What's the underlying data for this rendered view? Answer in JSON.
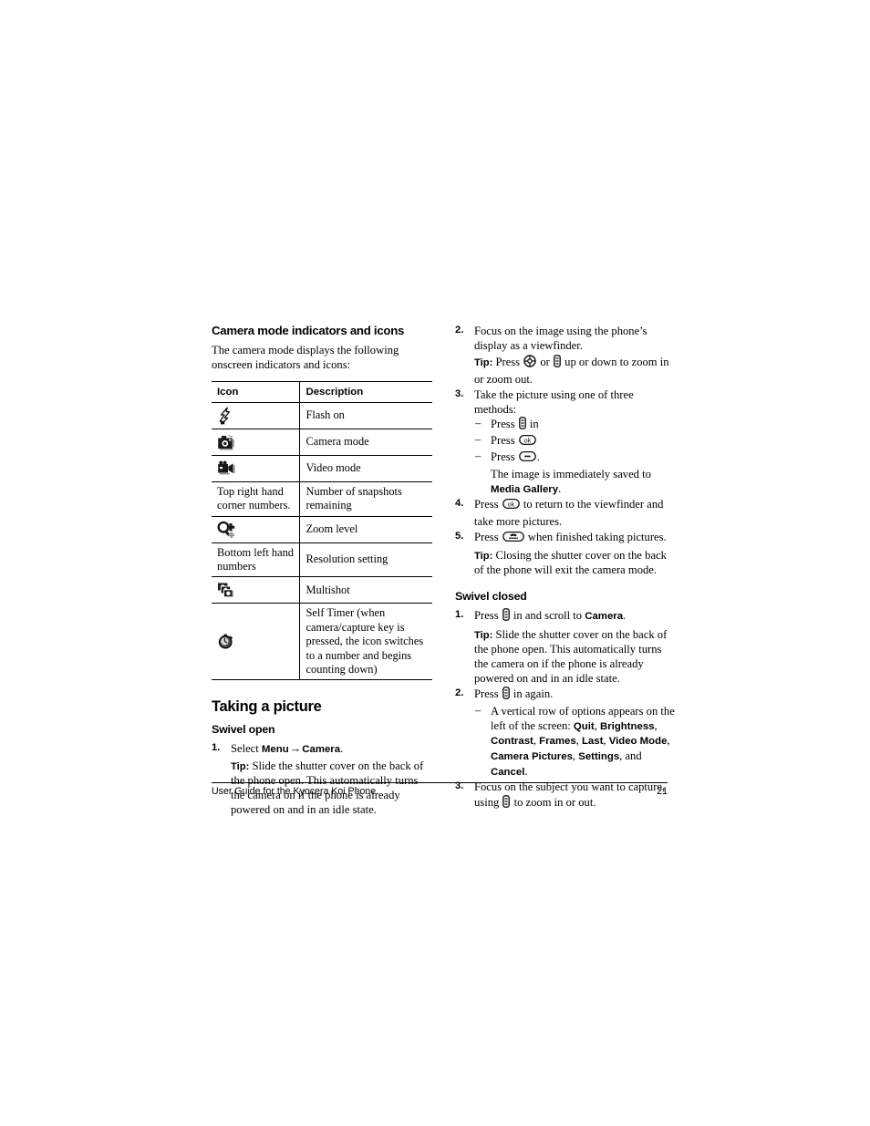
{
  "document": {
    "footer_title": "User Guide for the Kyocera Koi Phone",
    "page_number": "21"
  },
  "left_column": {
    "heading": "Camera mode indicators and icons",
    "intro": "The camera mode displays the following onscreen indicators and icons:",
    "table": {
      "headers": [
        "Icon",
        "Description"
      ],
      "rows": [
        {
          "icon_type": "image",
          "icon_name": "flash-on-icon",
          "icon_text": "",
          "description": "Flash on"
        },
        {
          "icon_type": "image",
          "icon_name": "camera-mode-icon",
          "icon_text": "",
          "description": "Camera mode"
        },
        {
          "icon_type": "image",
          "icon_name": "video-mode-icon",
          "icon_text": "",
          "description": "Video mode"
        },
        {
          "icon_type": "text",
          "icon_name": "top-right-hand-corner-numbers",
          "icon_text": "Top right hand corner numbers.",
          "description": "Number of snapshots remaining"
        },
        {
          "icon_type": "image",
          "icon_name": "zoom-level-icon",
          "icon_text": "",
          "description": "Zoom level"
        },
        {
          "icon_type": "text",
          "icon_name": "bottom-left-hand-numbers",
          "icon_text": "Bottom left hand numbers",
          "description": "Resolution setting"
        },
        {
          "icon_type": "image",
          "icon_name": "multishot-icon",
          "icon_text": "",
          "description": "Multishot"
        },
        {
          "icon_type": "image",
          "icon_name": "self-timer-icon",
          "icon_text": "",
          "description": "Self Timer  (when camera/capture key is pressed, the icon switches to a number and begins counting down)"
        }
      ]
    },
    "taking_a_picture_heading": "Taking a picture",
    "swivel_open": {
      "heading": "Swivel open",
      "step1_num": "1.",
      "step1_pre": "Select ",
      "step1_menu": "Menu",
      "step1_arrow": "→",
      "step1_camera": "Camera",
      "step1_post": ".",
      "tip_label": "Tip:",
      "tip_text": "Slide the shutter cover on the back of the phone open. This automatically turns the camera on if the phone is already powered on and in an idle state."
    }
  },
  "right_column": {
    "step2": {
      "num": "2.",
      "text": "Focus on the image using the phone’s display as a viewfinder.",
      "tip_label": "Tip:",
      "tip_pre": "Press ",
      "tip_mid": " or ",
      "tip_post": " up or down to zoom in or zoom out."
    },
    "step3": {
      "num": "3.",
      "text": "Take the picture using one of three methods:",
      "bullets": [
        {
          "pre": "Press ",
          "icon": "side-key-icon",
          "post": " in"
        },
        {
          "pre": "Press ",
          "icon": "ok-key-icon",
          "post": ""
        },
        {
          "pre": "Press ",
          "icon": "soft-key-icon",
          "post": "."
        }
      ],
      "saved_text": "The image is immediately saved to ",
      "saved_bold": "Media Gallery",
      "saved_post": "."
    },
    "step4": {
      "num": "4.",
      "pre": "Press ",
      "post": " to return to the viewfinder and take more pictures."
    },
    "step5": {
      "num": "5.",
      "pre": "Press ",
      "post": " when finished taking pictures.",
      "tip_label": "Tip:",
      "tip_text": "Closing the shutter cover on the back of the phone will exit the camera mode."
    },
    "swivel_closed": {
      "heading": "Swivel closed",
      "step1": {
        "num": "1.",
        "pre": "Press ",
        "mid": " in and scroll to ",
        "bold": "Camera",
        "post": ".",
        "tip_label": "Tip:",
        "tip_text": "Slide the shutter cover on the back of the phone open. This automatically turns the camera on if the phone is already powered on and in an idle state."
      },
      "step2": {
        "num": "2.",
        "pre": "Press ",
        "post": " in again.",
        "bullet_pre": "A vertical row of options appears on the left of the screen: ",
        "options": [
          "Quit",
          "Brightness",
          "Contrast",
          "Frames",
          "Last",
          "Video Mode",
          "Camera Pictures",
          "Settings"
        ],
        "options_and": ", and ",
        "options_last": "Cancel",
        "options_end": "."
      },
      "step3": {
        "num": "3.",
        "pre": "Focus on the subject you want to capture, using ",
        "post": " to zoom in or out."
      }
    }
  },
  "colors": {
    "text": "#000000",
    "rule": "#000000",
    "background": "#ffffff"
  }
}
